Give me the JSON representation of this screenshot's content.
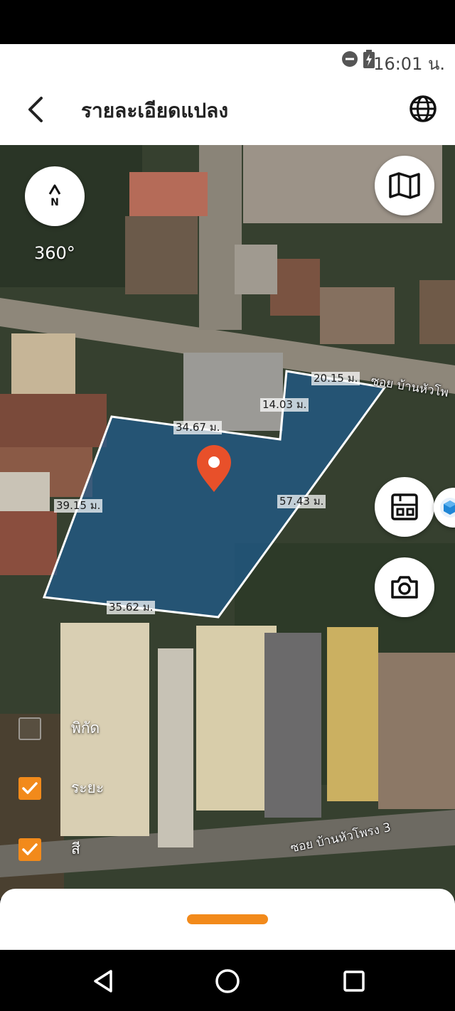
{
  "status_bar": {
    "time": "16:01 น.",
    "icons": [
      "do-not-disturb-icon",
      "battery-charging-icon"
    ]
  },
  "header": {
    "title": "รายละเอียดแปลง",
    "back_icon": "back-arrow-icon",
    "language_icon": "globe-icon"
  },
  "map": {
    "compass": {
      "label": "N",
      "icon": "compass-arrow-icon"
    },
    "rotation": "360°",
    "controls": [
      "map-layers-icon",
      "floorplan-icon",
      "camera-icon",
      "cube-3d-icon"
    ],
    "dimensions": {
      "top_right": "20.15 ม.",
      "notch_vertical": "14.03 ม.",
      "notch_horizontal": "34.67 ม.",
      "left_side": "39.15 ม.",
      "right_side": "57.43 ม.",
      "bottom_side": "35.62 ม."
    },
    "road_labels": {
      "top": "ซอย บ้านหัวโพ",
      "bottom": "ซอย บ้านหัวโพรง 3"
    },
    "parcel_fill": "#1f5b8f",
    "marker_color": "#e8502a"
  },
  "options": [
    {
      "label": "พิกัด",
      "checked": false
    },
    {
      "label": "ระยะ",
      "checked": true
    },
    {
      "label": "สี",
      "checked": true
    }
  ],
  "colors": {
    "accent": "#f28a1b"
  },
  "nav": [
    "back-triangle-icon",
    "home-circle-icon",
    "recents-square-icon"
  ]
}
